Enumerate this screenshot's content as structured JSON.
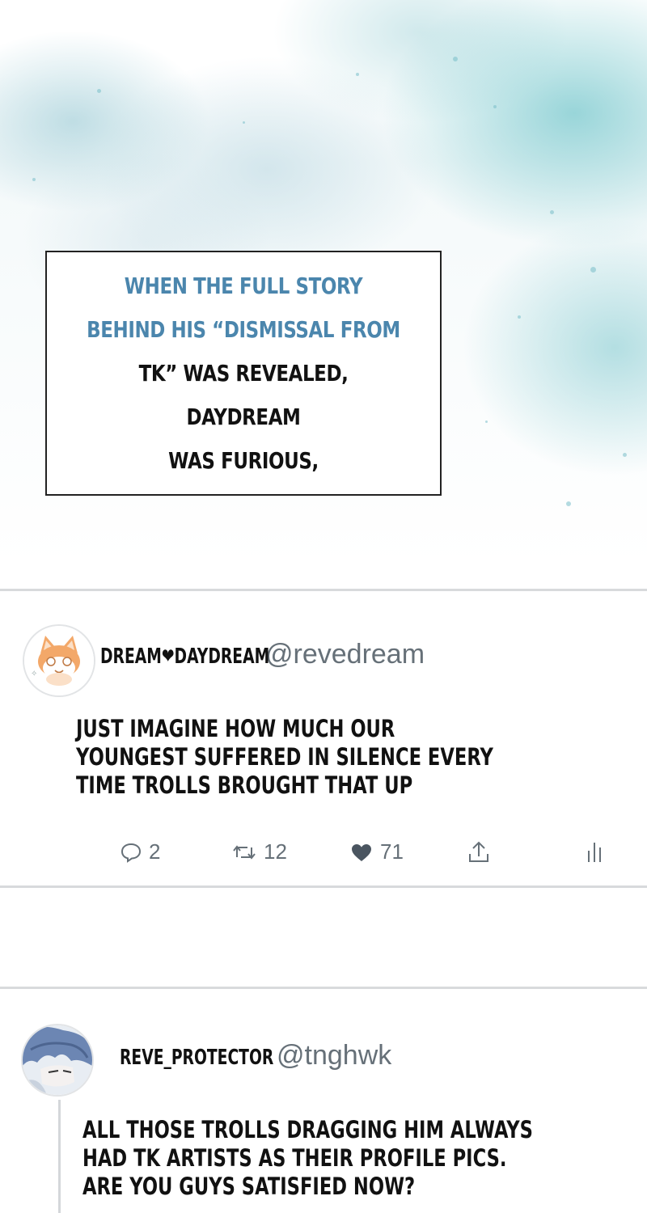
{
  "narration": {
    "lines": [
      "WHEN THE FULL STORY",
      "BEHIND HIS “DISMISSAL FROM",
      "TK” WAS REVEALED, DAYDREAM",
      "WAS FURIOUS,"
    ]
  },
  "post1": {
    "display_name": "DREAM❤DAYDREAM",
    "username": "@revedream",
    "text_lines": [
      "JUST IMAGINE HOW MUCH OUR",
      "YOUNGEST SUFFERED IN SILENCE EVERY",
      "TIME TROLLS BROUGHT THAT UP"
    ],
    "replies": "2",
    "retweets": "12",
    "likes": "71",
    "avatar_icon": "cat-avatar-icon"
  },
  "post2": {
    "display_name": "REVE_PROTECTOR",
    "username": "@tnghwk",
    "text_lines": [
      "ALL THOSE TROLLS DRAGGING HIM ALWAYS",
      "HAD TK ARTISTS AS THEIR PROFILE PICS.",
      "ARE YOU GUYS SATISFIED NOW?"
    ],
    "avatar_icon": "character-avatar-icon"
  },
  "colors": {
    "narration_blue": "#4b86ad",
    "muted_gray": "#667078",
    "like_heart": "#4a5560"
  }
}
